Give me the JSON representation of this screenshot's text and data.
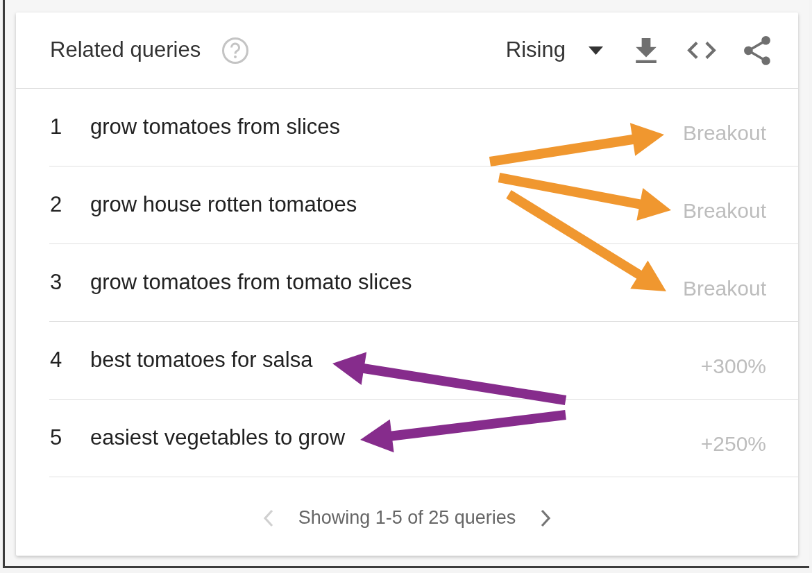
{
  "header": {
    "title": "Related queries",
    "filter": "Rising"
  },
  "rows": [
    {
      "rank": "1",
      "query": "grow tomatoes from slices",
      "change": "Breakout"
    },
    {
      "rank": "2",
      "query": "grow house rotten tomatoes",
      "change": "Breakout"
    },
    {
      "rank": "3",
      "query": "grow tomatoes from tomato slices",
      "change": "Breakout"
    },
    {
      "rank": "4",
      "query": "best tomatoes for salsa",
      "change": "+300%"
    },
    {
      "rank": "5",
      "query": "easiest vegetables to grow",
      "change": "+250%"
    }
  ],
  "pagination": {
    "summary": "Showing 1-5 of 25 queries",
    "previous": {
      "disabled": true
    },
    "next": {
      "disabled": false
    }
  }
}
